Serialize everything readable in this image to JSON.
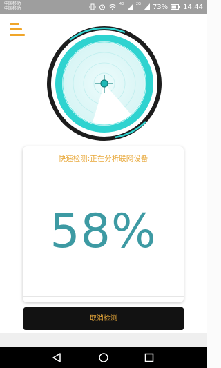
{
  "status_bar": {
    "carrier_1": "中国移动",
    "carrier_2": "中国移动",
    "battery": "73%",
    "time": "14:44",
    "signal_tag_1": "4G",
    "signal_tag_2": "2G"
  },
  "app": {
    "menu_icon": "hamburger-menu-icon",
    "radar_icon": "radar-scan-icon"
  },
  "scan": {
    "status_text": "快速检测:正在分析联网设备",
    "progress_text": "58%",
    "progress": 0.58
  },
  "actions": {
    "cancel_label": "取消检测"
  },
  "navigation": {
    "back_icon": "back-triangle-icon",
    "home_icon": "home-circle-icon",
    "recent_icon": "recent-square-icon"
  },
  "colors": {
    "accent_orange": "#e8a83a",
    "teal": "#3d9aa3",
    "radar_cyan": "#2fd3d0",
    "button_black": "#121212"
  }
}
